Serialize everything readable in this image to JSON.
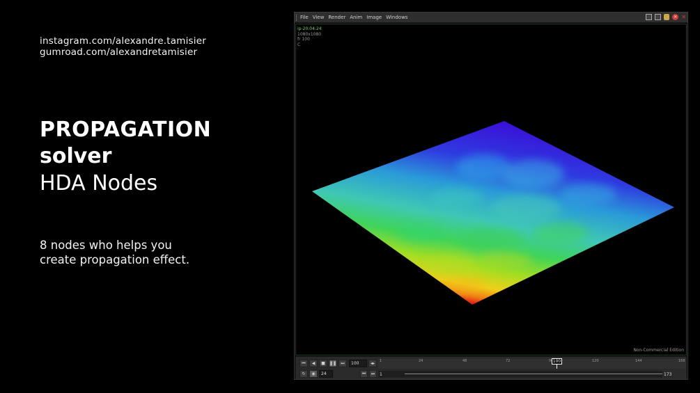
{
  "slide": {
    "links": [
      "instagram.com/alexandre.tamisier",
      "gumroad.com/alexandretamisier"
    ],
    "title_line1": "PROPAGATION",
    "title_line2": "solver",
    "title_line3": "HDA Nodes",
    "description": "8 nodes who helps you create propagation effect."
  },
  "window": {
    "menu": [
      "File",
      "View",
      "Render",
      "Anim",
      "Image",
      "Windows"
    ],
    "hud": {
      "name": "ip-20:04:24",
      "resolution": "1080x1080",
      "frame": "fr 100",
      "channel": "C"
    },
    "edition": "Non-Commercial Edition"
  },
  "timeline": {
    "fps": "24",
    "current_frame_field": "100",
    "cursor_frame": "100",
    "start": "1",
    "end": "173",
    "ticks": [
      "1",
      "24",
      "48",
      "72",
      "96",
      "120",
      "144",
      "168"
    ]
  },
  "colors": {
    "accent_green": "#74d36a",
    "close_red": "#d23b3b"
  }
}
